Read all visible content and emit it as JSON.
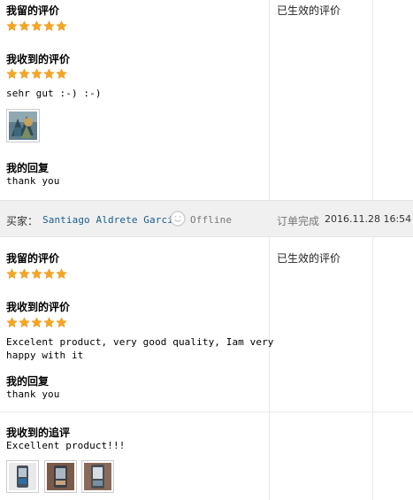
{
  "review1": {
    "my_review_heading": "我留的评价",
    "my_review_stars": 5,
    "received_heading": "我收到的评价",
    "received_stars": 5,
    "received_text": "sehr gut :-) :-)",
    "reply_heading": "我的回复",
    "reply_text": "thank you",
    "status": "已生效的评价"
  },
  "buyer_bar": {
    "label": "买家：",
    "buyer_name": "Santiago Aldrete Garcia",
    "online_status": "Offline",
    "order_status": "订单完成",
    "order_date": "2016.11.28 16:54"
  },
  "review2": {
    "my_review_heading": "我留的评价",
    "my_review_stars": 5,
    "received_heading": "我收到的评价",
    "received_stars": 5,
    "received_text_line1": "Excelent product, very good quality, Iam very",
    "received_text_line2": "happy with it",
    "reply_heading": "我的回复",
    "reply_text": "thank you",
    "status": "已生效的评价",
    "followup_heading": "我收到的追评",
    "followup_text": "Excellent product!!!"
  },
  "colors": {
    "star": "#f5a623",
    "link": "#1a5e8e",
    "bar_background": "#f0f0f0"
  },
  "icons": {
    "star": "star-icon",
    "online": "offline-status-icon"
  }
}
